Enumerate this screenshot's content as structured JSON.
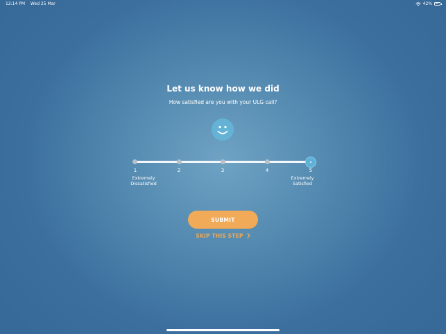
{
  "status_bar": {
    "time": "12:14 PM",
    "date": "Wed 25 Mar",
    "battery": "42%"
  },
  "survey": {
    "title": "Let us know how we did",
    "question": "How satisfied are you with your ULG call?",
    "selected_value": 5,
    "scale": [
      {
        "value": "1",
        "label_line1": "Extremely",
        "label_line2": "Dissatisfied"
      },
      {
        "value": "2",
        "label_line1": "",
        "label_line2": ""
      },
      {
        "value": "3",
        "label_line1": "",
        "label_line2": ""
      },
      {
        "value": "4",
        "label_line1": "",
        "label_line2": ""
      },
      {
        "value": "5",
        "label_line1": "Extremely",
        "label_line2": "Satisfied"
      }
    ]
  },
  "actions": {
    "submit_label": "SUBMIT",
    "skip_label": "SKIP THIS STEP"
  },
  "colors": {
    "accent": "#f1aa57",
    "face": "#64b3d6",
    "background": "#3c6f9e"
  },
  "icons": {
    "face": "smiley-face-icon",
    "skip": "chevron-right-icon",
    "wifi": "wifi-icon",
    "battery": "battery-icon"
  }
}
